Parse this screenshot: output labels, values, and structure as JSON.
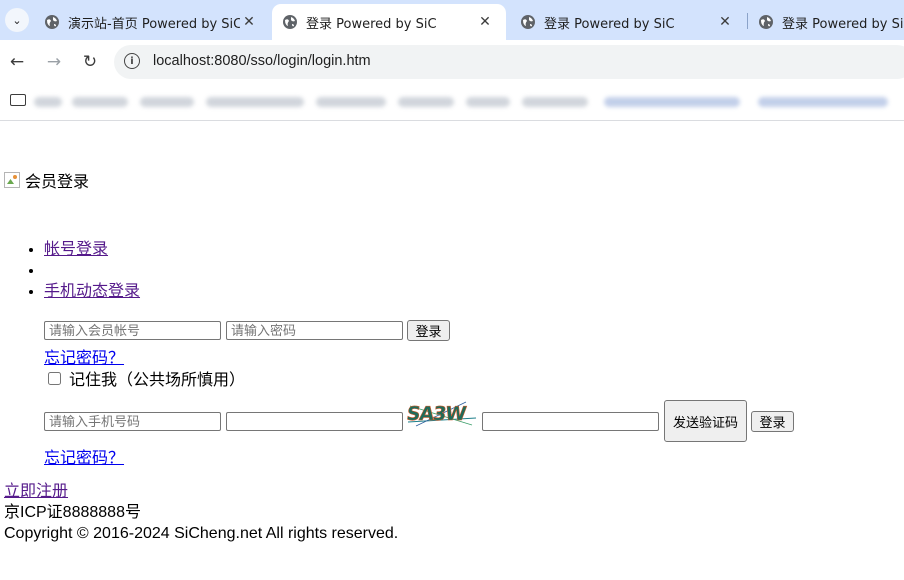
{
  "browser": {
    "tabs": [
      {
        "title": "演示站-首页 Powered by SiC",
        "active": false
      },
      {
        "title": "登录 Powered by SiC",
        "active": true
      },
      {
        "title": "登录 Powered by SiC",
        "active": false
      },
      {
        "title": "登录 Powered by SiC",
        "active": false
      }
    ],
    "url": "localhost:8080/sso/login/login.htm"
  },
  "page": {
    "header_title": "会员登录",
    "tabs": [
      "帐号登录",
      "",
      "手机动态登录"
    ],
    "account_login": {
      "account_placeholder": "请输入会员帐号",
      "password_placeholder": "请输入密码",
      "login_button": "登录",
      "forgot_link": "忘记密码？",
      "remember_label": "记住我（公共场所慎用）"
    },
    "phone_login": {
      "phone_placeholder": "请输入手机号码",
      "captcha_text": "SA3W",
      "send_code_button": "发送验证码",
      "login_button": "登录",
      "forgot_link": "忘记密码？"
    },
    "footer": {
      "register_link": "立即注册",
      "icp": "京ICP证8888888号",
      "copyright": "Copyright © 2016-2024 SiCheng.net All rights reserved."
    }
  }
}
